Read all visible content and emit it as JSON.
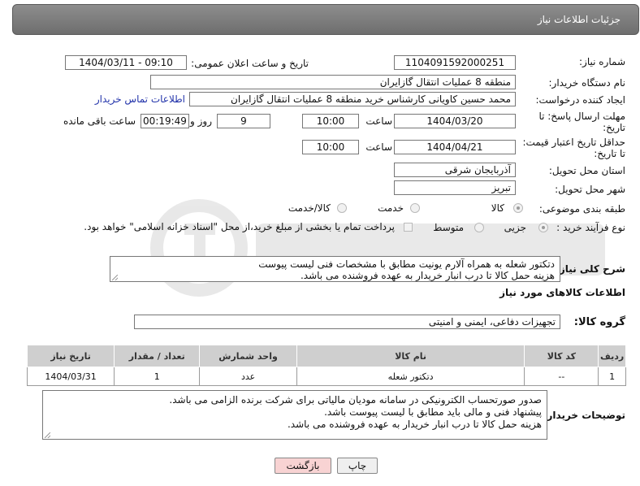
{
  "header": {
    "title": "جزئیات اطلاعات نیاز"
  },
  "fields": {
    "need_number_label": "شماره نیاز:",
    "need_number": "1104091592000251",
    "announce_label": "تاریخ و ساعت اعلان عمومی:",
    "announce_value": "1404/03/11 - 09:10",
    "buyer_org_label": "نام دستگاه خریدار:",
    "buyer_org": "منطقه 8 عملیات انتقال گازایران",
    "creator_label": "ایجاد کننده درخواست:",
    "creator": "محمد حسین کاویانی کارشناس خرید منطقه 8 عملیات انتقال گازایران",
    "contact_link": "اطلاعات تماس خریدار",
    "deadline_label_1": "مهلت ارسال پاسخ: تا",
    "deadline_label_2": "تاریخ:",
    "deadline_date": "1404/03/20",
    "time_label": "ساعت",
    "deadline_time": "10:00",
    "days_value": "9",
    "days_label": "روز و",
    "remaining_time": "00:19:49",
    "remaining_label": "ساعت باقی مانده",
    "validity_label_1": "حداقل تاریخ اعتبار قیمت:",
    "validity_label_2": "تا تاریخ:",
    "validity_date": "1404/04/21",
    "validity_time": "10:00",
    "province_label": "استان محل تحویل:",
    "province": "آذربایجان شرقی",
    "city_label": "شهر محل تحویل:",
    "city": "تبریز",
    "category_label": "طبقه بندی موضوعی:",
    "category_options": [
      "کالا",
      "خدمت",
      "کالا/خدمت"
    ],
    "category_selected": "کالا",
    "process_label": "نوع فرآیند خرید :",
    "process_options": [
      "جزیی",
      "متوسط"
    ],
    "process_selected": "جزیی",
    "payment_note": "پرداخت تمام یا بخشی از مبلغ خرید،از محل \"اسناد خزانه اسلامی\" خواهد بود.",
    "description_label": "شرح کلی نیاز:",
    "description_lines": [
      "دتکتور شعله به همراه آلارم یونیت مطابق با مشخصات فنی لیست پیوست",
      "هزینه حمل کالا تا درب انبار خریدار به عهده فروشنده می باشد."
    ]
  },
  "goods": {
    "section_title": "اطلاعات کالاهای مورد نیاز",
    "group_label": "گروه کالا:",
    "group_value": "تجهیزات دفاعی، ایمنی و امنیتی",
    "columns": [
      "ردیف",
      "کد کالا",
      "نام کالا",
      "واحد شمارش",
      "تعداد / مقدار",
      "تاریخ نیاز"
    ],
    "rows": [
      [
        "1",
        "--",
        "دتکتور شعله",
        "عدد",
        "1",
        "1404/03/31"
      ]
    ]
  },
  "notes": {
    "label": "توضیحات خریدار:",
    "lines": [
      "صدور صورتحساب الکترونیکی در سامانه مودیان مالیاتی برای شرکت برنده الزامی می باشد.",
      "پیشنهاد فنی و مالی باید مطابق با لیست پیوست باشد.",
      "هزینه حمل کالا تا درب انبار خریدار به عهده فروشنده می باشد."
    ]
  },
  "buttons": {
    "print": "چاپ",
    "back": "بازگشت"
  },
  "colors": {
    "header_bg": "#7d7d7d",
    "link": "#2233aa",
    "back_button_bg": "#f8d3d3"
  }
}
